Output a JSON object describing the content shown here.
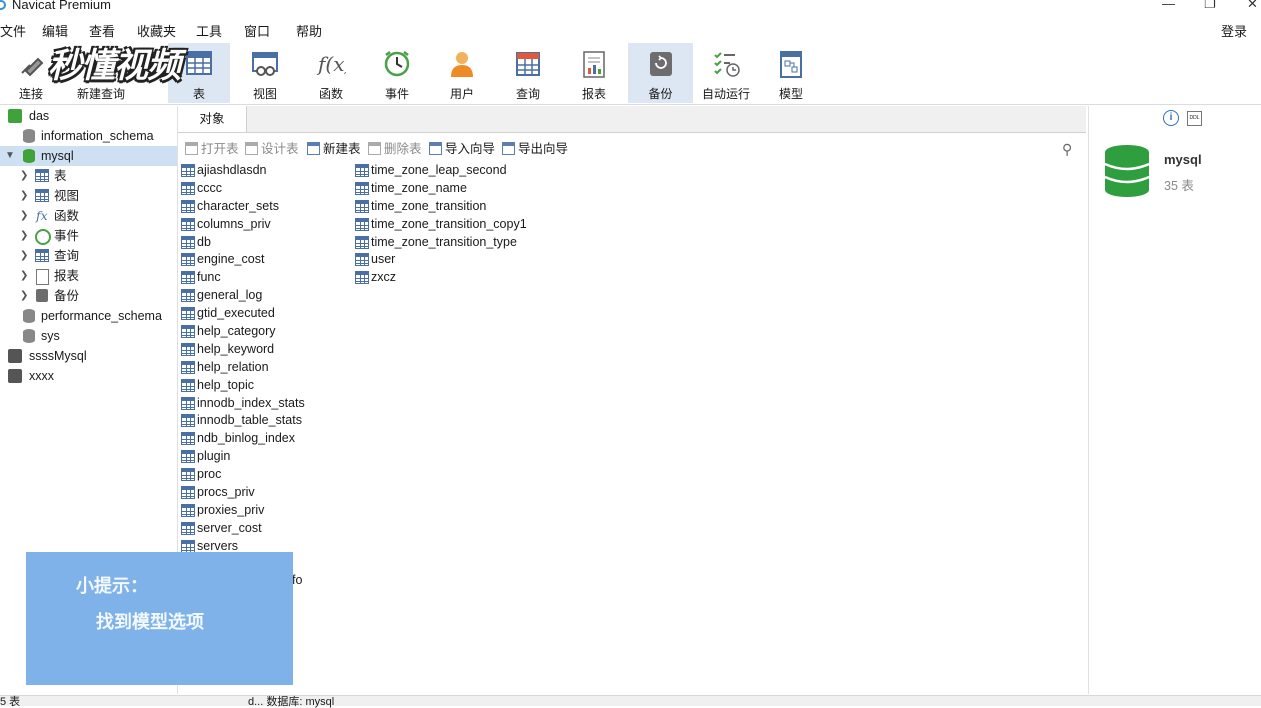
{
  "window": {
    "title": "Navicat Premium"
  },
  "menu": [
    "文件",
    "编辑",
    "查看",
    "收藏夹",
    "工具",
    "窗口",
    "帮助"
  ],
  "login_label": "登录",
  "watermark": "秒懂视频",
  "toolbar": [
    {
      "label": "连接"
    },
    {
      "label": "新建查询"
    },
    {
      "label": "表"
    },
    {
      "label": "视图"
    },
    {
      "label": "函数"
    },
    {
      "label": "事件"
    },
    {
      "label": "用户"
    },
    {
      "label": "查询"
    },
    {
      "label": "报表"
    },
    {
      "label": "备份"
    },
    {
      "label": "自动运行"
    },
    {
      "label": "模型"
    }
  ],
  "tree": {
    "das": "das",
    "information_schema": "information_schema",
    "mysql": "mysql",
    "children": [
      "表",
      "视图",
      "函数",
      "事件",
      "查询",
      "报表",
      "备份"
    ],
    "performance_schema": "performance_schema",
    "sys": "sys",
    "conn2": "ssssMysql",
    "conn3": "xxxx"
  },
  "tab_label": "对象",
  "object_toolbar": [
    "打开表",
    "设计表",
    "新建表",
    "删除表",
    "导入向导",
    "导出向导"
  ],
  "tables_col1": [
    "ajiashdlasdn",
    "cccc",
    "character_sets",
    "columns_priv",
    "db",
    "engine_cost",
    "func",
    "general_log",
    "gtid_executed",
    "help_category",
    "help_keyword",
    "help_relation",
    "help_topic",
    "innodb_index_stats",
    "innodb_table_stats",
    "ndb_binlog_index",
    "plugin",
    "proc",
    "procs_priv",
    "proxies_priv",
    "server_cost",
    "servers"
  ],
  "tables_col2": [
    "time_zone_leap_second",
    "time_zone_name",
    "time_zone_transition",
    "time_zone_transition_copy1",
    "time_zone_transition_type",
    "user",
    "zxcz"
  ],
  "hidden_fragment": "fo",
  "info_panel": {
    "db_name": "mysql",
    "table_count": "35 表"
  },
  "overlay": {
    "line1": "小提示：",
    "line2": "找到模型选项"
  },
  "status": {
    "left": "5 表",
    "mid": "d... 数据库: mysql"
  }
}
